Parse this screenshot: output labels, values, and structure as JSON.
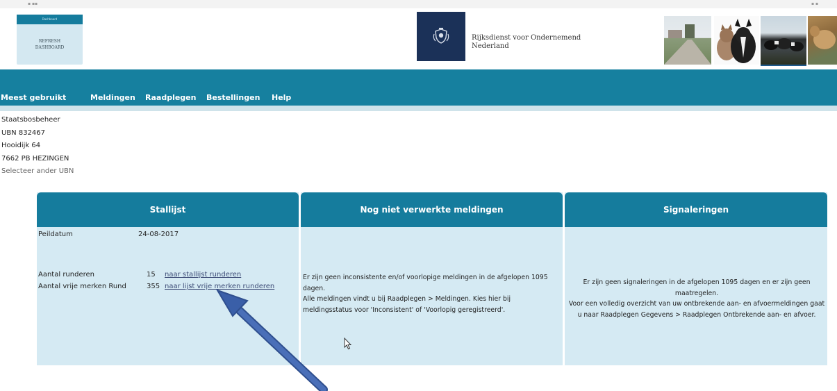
{
  "dashboard_button": {
    "top": "Dashboard",
    "label_line1": "REFRESH",
    "label_line2": "DASHBOARD"
  },
  "org": {
    "name": "Rijksdienst voor Ondernemend\nNederland",
    "logo_icon": "coat-of-arms-icon"
  },
  "nav": {
    "items": [
      "Meest gebruikt",
      "Meldingen",
      "Raadplegen",
      "Bestellingen",
      "Help"
    ]
  },
  "address": {
    "name": "Staatsbosbeheer",
    "ubn": "UBN 832467",
    "street": "Hooidijk 64",
    "city": "7662 PB HEZINGEN",
    "select_other": "Selecteer ander UBN"
  },
  "panels": {
    "stallijst": {
      "title": "Stallijst",
      "peildatum_label": "Peildatum",
      "peildatum_value": "24-08-2017",
      "runderen_label": "Aantal runderen",
      "runderen_value": "15",
      "runderen_link": "naar stallijst runderen",
      "merken_label": "Aantal vrije merken Rund",
      "merken_value": "355",
      "merken_link": "naar lijst vrije merken runderen"
    },
    "meldingen": {
      "title": "Nog niet verwerkte meldingen",
      "text": "Er zijn geen inconsistente en/of voorlopige meldingen in de afgelopen 1095 dagen.\nAlle meldingen vindt u bij Raadplegen > Meldingen. Kies hier bij meldingsstatus voor 'Inconsistent' of 'Voorlopig geregistreerd'."
    },
    "signaleringen": {
      "title": "Signaleringen",
      "text": "Er zijn geen signaleringen in de afgelopen 1095 dagen en er zijn geen maatregelen.\nVoor een volledig overzicht van uw ontbrekende aan- en afvoermeldingen gaat u naar Raadplegen Gegevens > Raadplegen Ontbrekende aan- en afvoer."
    }
  },
  "colors": {
    "nav_bg": "#16809f",
    "panel_header": "#157c9d",
    "panel_body": "#d5eaf3",
    "arrow": "#3a5fa8"
  }
}
